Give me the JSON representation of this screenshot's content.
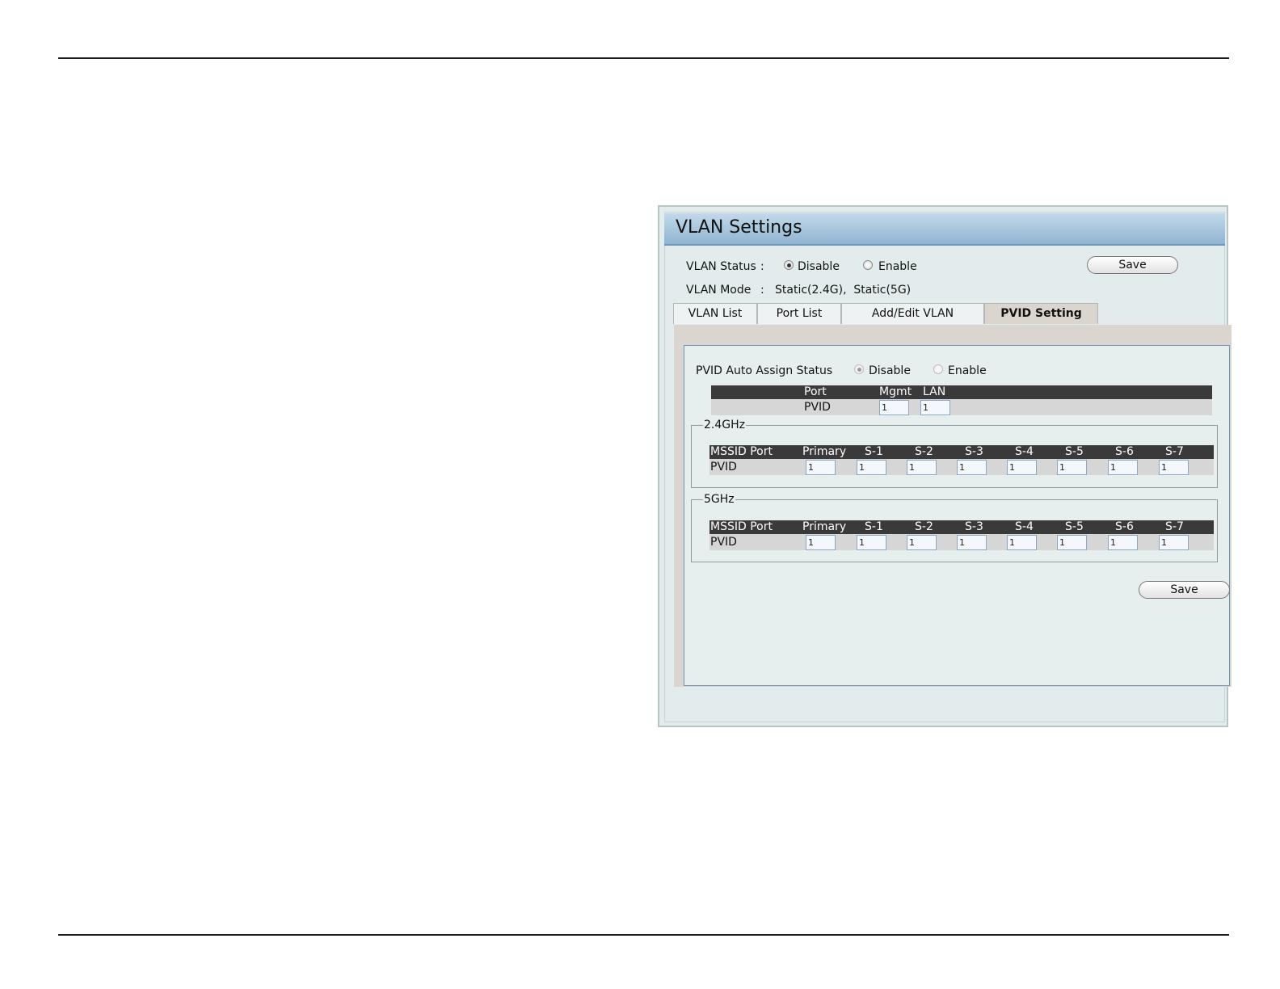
{
  "panel": {
    "title": "VLAN Settings",
    "vlan_status": {
      "label": "VLAN Status",
      "separator": ":",
      "options": [
        "Disable",
        "Enable"
      ],
      "selected": "Disable"
    },
    "vlan_mode": {
      "label": "VLAN Mode",
      "separator": ":",
      "value": "Static(2.4G),  Static(5G)"
    },
    "save_label": "Save"
  },
  "tabs": [
    {
      "label": "VLAN List",
      "active": false
    },
    {
      "label": "Port List",
      "active": false
    },
    {
      "label": "Add/Edit VLAN",
      "active": false
    },
    {
      "label": "PVID Setting",
      "active": true
    }
  ],
  "pvid": {
    "auto_assign": {
      "label": "PVID Auto Assign Status",
      "options": [
        "Disable",
        "Enable"
      ],
      "selected": "Disable"
    },
    "port_table": {
      "headers": [
        "Port",
        "Mgmt",
        "LAN"
      ],
      "row_label": "PVID",
      "values": [
        "1",
        "1"
      ]
    },
    "band_24": {
      "legend": "2.4GHz",
      "headers": [
        "MSSID Port",
        "Primary",
        "S-1",
        "S-2",
        "S-3",
        "S-4",
        "S-5",
        "S-6",
        "S-7"
      ],
      "row_label": "PVID",
      "values": [
        "1",
        "1",
        "1",
        "1",
        "1",
        "1",
        "1",
        "1"
      ]
    },
    "band_5": {
      "legend": "5GHz",
      "headers": [
        "MSSID Port",
        "Primary",
        "S-1",
        "S-2",
        "S-3",
        "S-4",
        "S-5",
        "S-6",
        "S-7"
      ],
      "row_label": "PVID",
      "values": [
        "1",
        "1",
        "1",
        "1",
        "1",
        "1",
        "1",
        "1"
      ]
    },
    "save_label": "Save"
  }
}
